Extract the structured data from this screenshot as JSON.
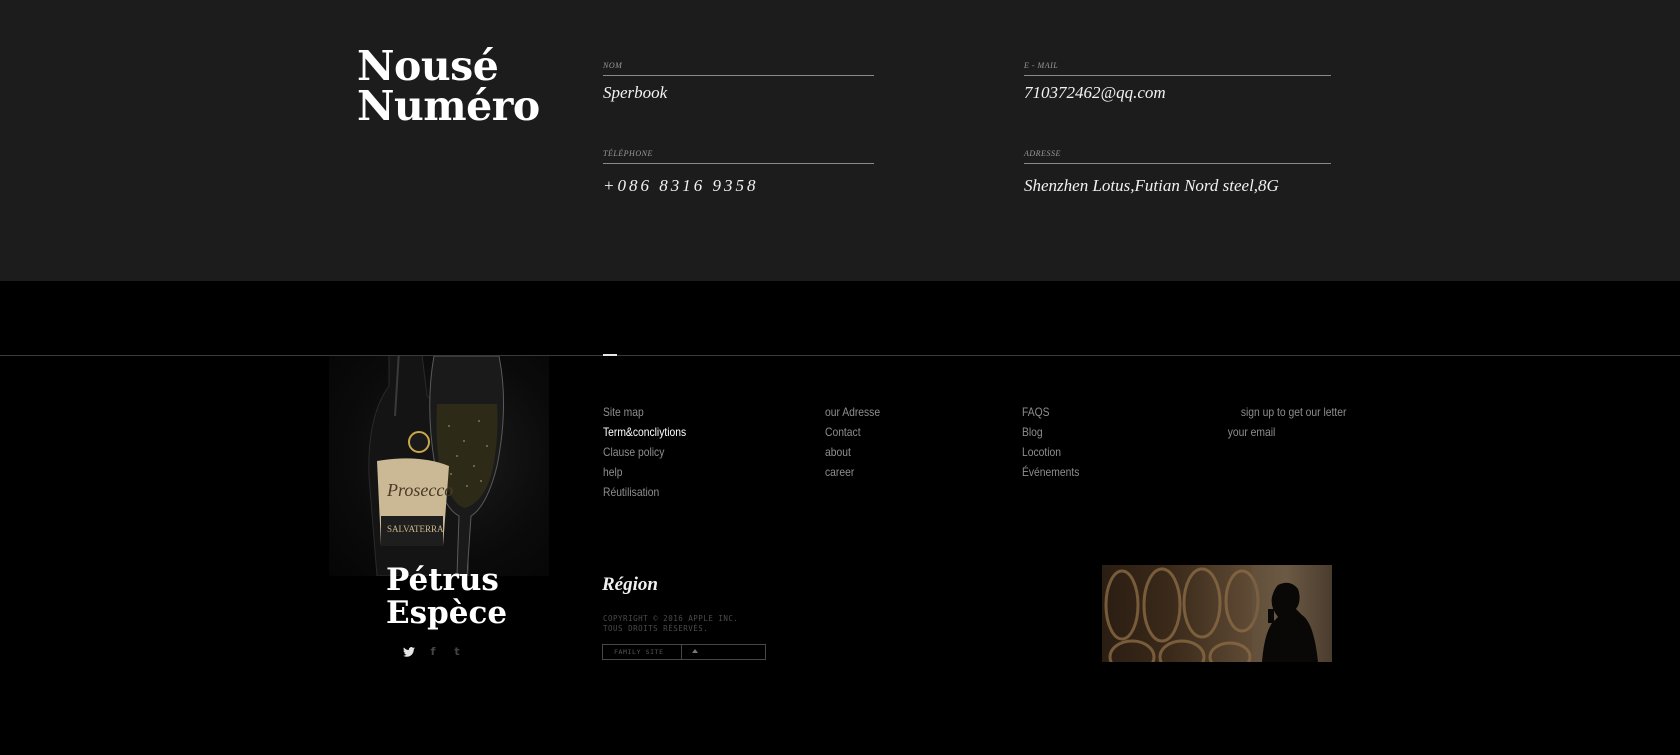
{
  "contact": {
    "brand_line1": "Nousé",
    "brand_line2": "Numéro",
    "fields": {
      "nom": {
        "label": "NOM",
        "value": "Sperbook"
      },
      "email": {
        "label": "E - MAIL",
        "value": "710372462@qq.com"
      },
      "telephone": {
        "label": "TÉLÉPHONE",
        "value": "+086 8316 9358"
      },
      "adresse": {
        "label": "ADRESSE",
        "value": "Shenzhen Lotus,Futian  Nord steel,8G"
      }
    }
  },
  "footer": {
    "product_brand_line1": "Pétrus",
    "product_brand_line2": "Espèce",
    "bottle_label": "Prosecco",
    "bottle_sublabel": "SALVATERRA",
    "social_icons": [
      "twitter-icon",
      "facebook-icon",
      "tumblr-icon"
    ],
    "columns": {
      "col1": [
        "Site map",
        "Term&concliytions",
        "Clause policy",
        "help",
        "Réutilisation"
      ],
      "col2": [
        "our Adresse",
        "Contact",
        "about",
        "career"
      ],
      "col3": [
        "FAQS",
        "Blog",
        "Locotion",
        "Événements"
      ],
      "col4_title": "sign up to get our letter",
      "col4_email_placeholder": "your email"
    },
    "region_title": "Région",
    "copyright_line1": "COPYRIGHT © 2016 APPLE INC.",
    "copyright_line2": "TOUS DROITS RÉSERVÉS.",
    "family_site_label": "FAMILY SITE"
  },
  "colors": {
    "contact_bg": "#1c1c1c",
    "footer_bg": "#000000",
    "muted_text": "#8e8e8e",
    "active_text": "#ffffff"
  }
}
